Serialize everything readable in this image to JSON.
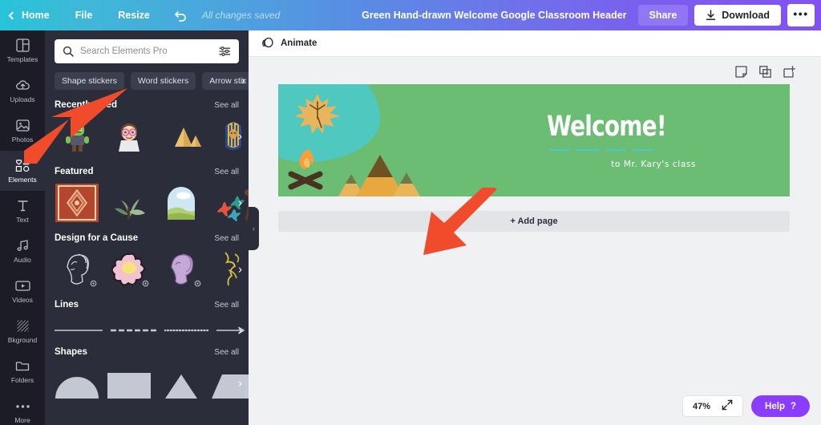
{
  "topbar": {
    "home_label": "Home",
    "file_label": "File",
    "resize_label": "Resize",
    "undo_icon": "undo-icon",
    "saved_status": "All changes saved",
    "design_title": "Green Hand-drawn Welcome Google Classroom Header",
    "share_label": "Share",
    "download_label": "Download",
    "more_label": "•••",
    "gradient_start": "#27c4d9",
    "gradient_end": "#8152f2"
  },
  "rail": {
    "items": [
      {
        "label": "Templates",
        "icon": "templates-icon",
        "active": false
      },
      {
        "label": "Uploads",
        "icon": "cloud-upload-icon",
        "active": false
      },
      {
        "label": "Photos",
        "icon": "image-icon",
        "active": false
      },
      {
        "label": "Elements",
        "icon": "elements-icon",
        "active": true
      },
      {
        "label": "Text",
        "icon": "text-icon",
        "active": false
      },
      {
        "label": "Audio",
        "icon": "music-note-icon",
        "active": false
      },
      {
        "label": "Videos",
        "icon": "video-icon",
        "active": false
      },
      {
        "label": "Bkground",
        "icon": "background-pattern-icon",
        "active": false
      },
      {
        "label": "Folders",
        "icon": "folder-icon",
        "active": false
      },
      {
        "label": "More",
        "icon": "ellipsis-icon",
        "active": false
      }
    ]
  },
  "panel": {
    "search": {
      "placeholder": "Search Elements Pro",
      "value": "",
      "search_icon": "search-icon",
      "filter_icon": "filter-sliders-icon"
    },
    "tabs": [
      {
        "label": "Shape stickers"
      },
      {
        "label": "Word stickers"
      },
      {
        "label": "Arrow stic"
      }
    ],
    "tabs_next_icon": "chevron-right-icon",
    "see_all_label": "See all",
    "sections": [
      {
        "title": "Recently used",
        "kind": "items",
        "items": [
          {
            "name": "orc-character-sticker"
          },
          {
            "name": "person-with-glasses-sticker"
          },
          {
            "name": "pyramids-sticker"
          },
          {
            "name": "pharaoh-sticker"
          }
        ]
      },
      {
        "title": "Featured",
        "kind": "items",
        "items": [
          {
            "name": "persian-rug-pattern"
          },
          {
            "name": "green-leaves-illustration"
          },
          {
            "name": "arch-landscape-illustration"
          },
          {
            "name": "flowers-illustration"
          }
        ]
      },
      {
        "title": "Design for a Cause",
        "kind": "items",
        "items": [
          {
            "name": "line-art-face-white",
            "pro": true
          },
          {
            "name": "pink-flower-egg",
            "pro": true
          },
          {
            "name": "line-art-face-purple",
            "pro": true
          },
          {
            "name": "yellow-figure-sketch",
            "pro": false
          }
        ]
      },
      {
        "title": "Lines",
        "kind": "lines",
        "items": [
          {
            "name": "solid-line"
          },
          {
            "name": "dashed-line"
          },
          {
            "name": "dotted-line"
          },
          {
            "name": "arrow-line"
          }
        ]
      },
      {
        "title": "Shapes",
        "kind": "shapes",
        "items": [
          {
            "name": "semicircle-shape"
          },
          {
            "name": "rectangle-shape"
          },
          {
            "name": "triangle-shape"
          },
          {
            "name": "trapezoid-shape"
          }
        ]
      }
    ],
    "collapse_icon": "chevron-left-icon"
  },
  "main": {
    "animate_label": "Animate",
    "animate_icon": "animate-icon",
    "page_tools": [
      {
        "name": "notes-icon"
      },
      {
        "name": "duplicate-page-icon"
      },
      {
        "name": "add-page-icon"
      }
    ],
    "add_page_label": "+ Add page",
    "design": {
      "background_color": "#6cbd74",
      "blob_color": "#4fc9bf",
      "title": "Welcome!",
      "subtitle": "to Mr. Kary's class",
      "elements": [
        {
          "name": "maple-leaf"
        },
        {
          "name": "campfire"
        },
        {
          "name": "mountains"
        },
        {
          "name": "teal-underline-dashes"
        }
      ]
    }
  },
  "bottom": {
    "zoom_level": "47%",
    "expand_icon": "expand-arrows-icon",
    "help_label": "Help",
    "help_suffix": "?",
    "help_color": "#8b3dff"
  },
  "annotations": {
    "arrow_color": "#f04b2a",
    "arrows": [
      {
        "name": "annotation-arrow-elements",
        "target": "elements-sidebar-item"
      },
      {
        "name": "annotation-arrow-canvas",
        "target": "design-canvas"
      }
    ]
  }
}
